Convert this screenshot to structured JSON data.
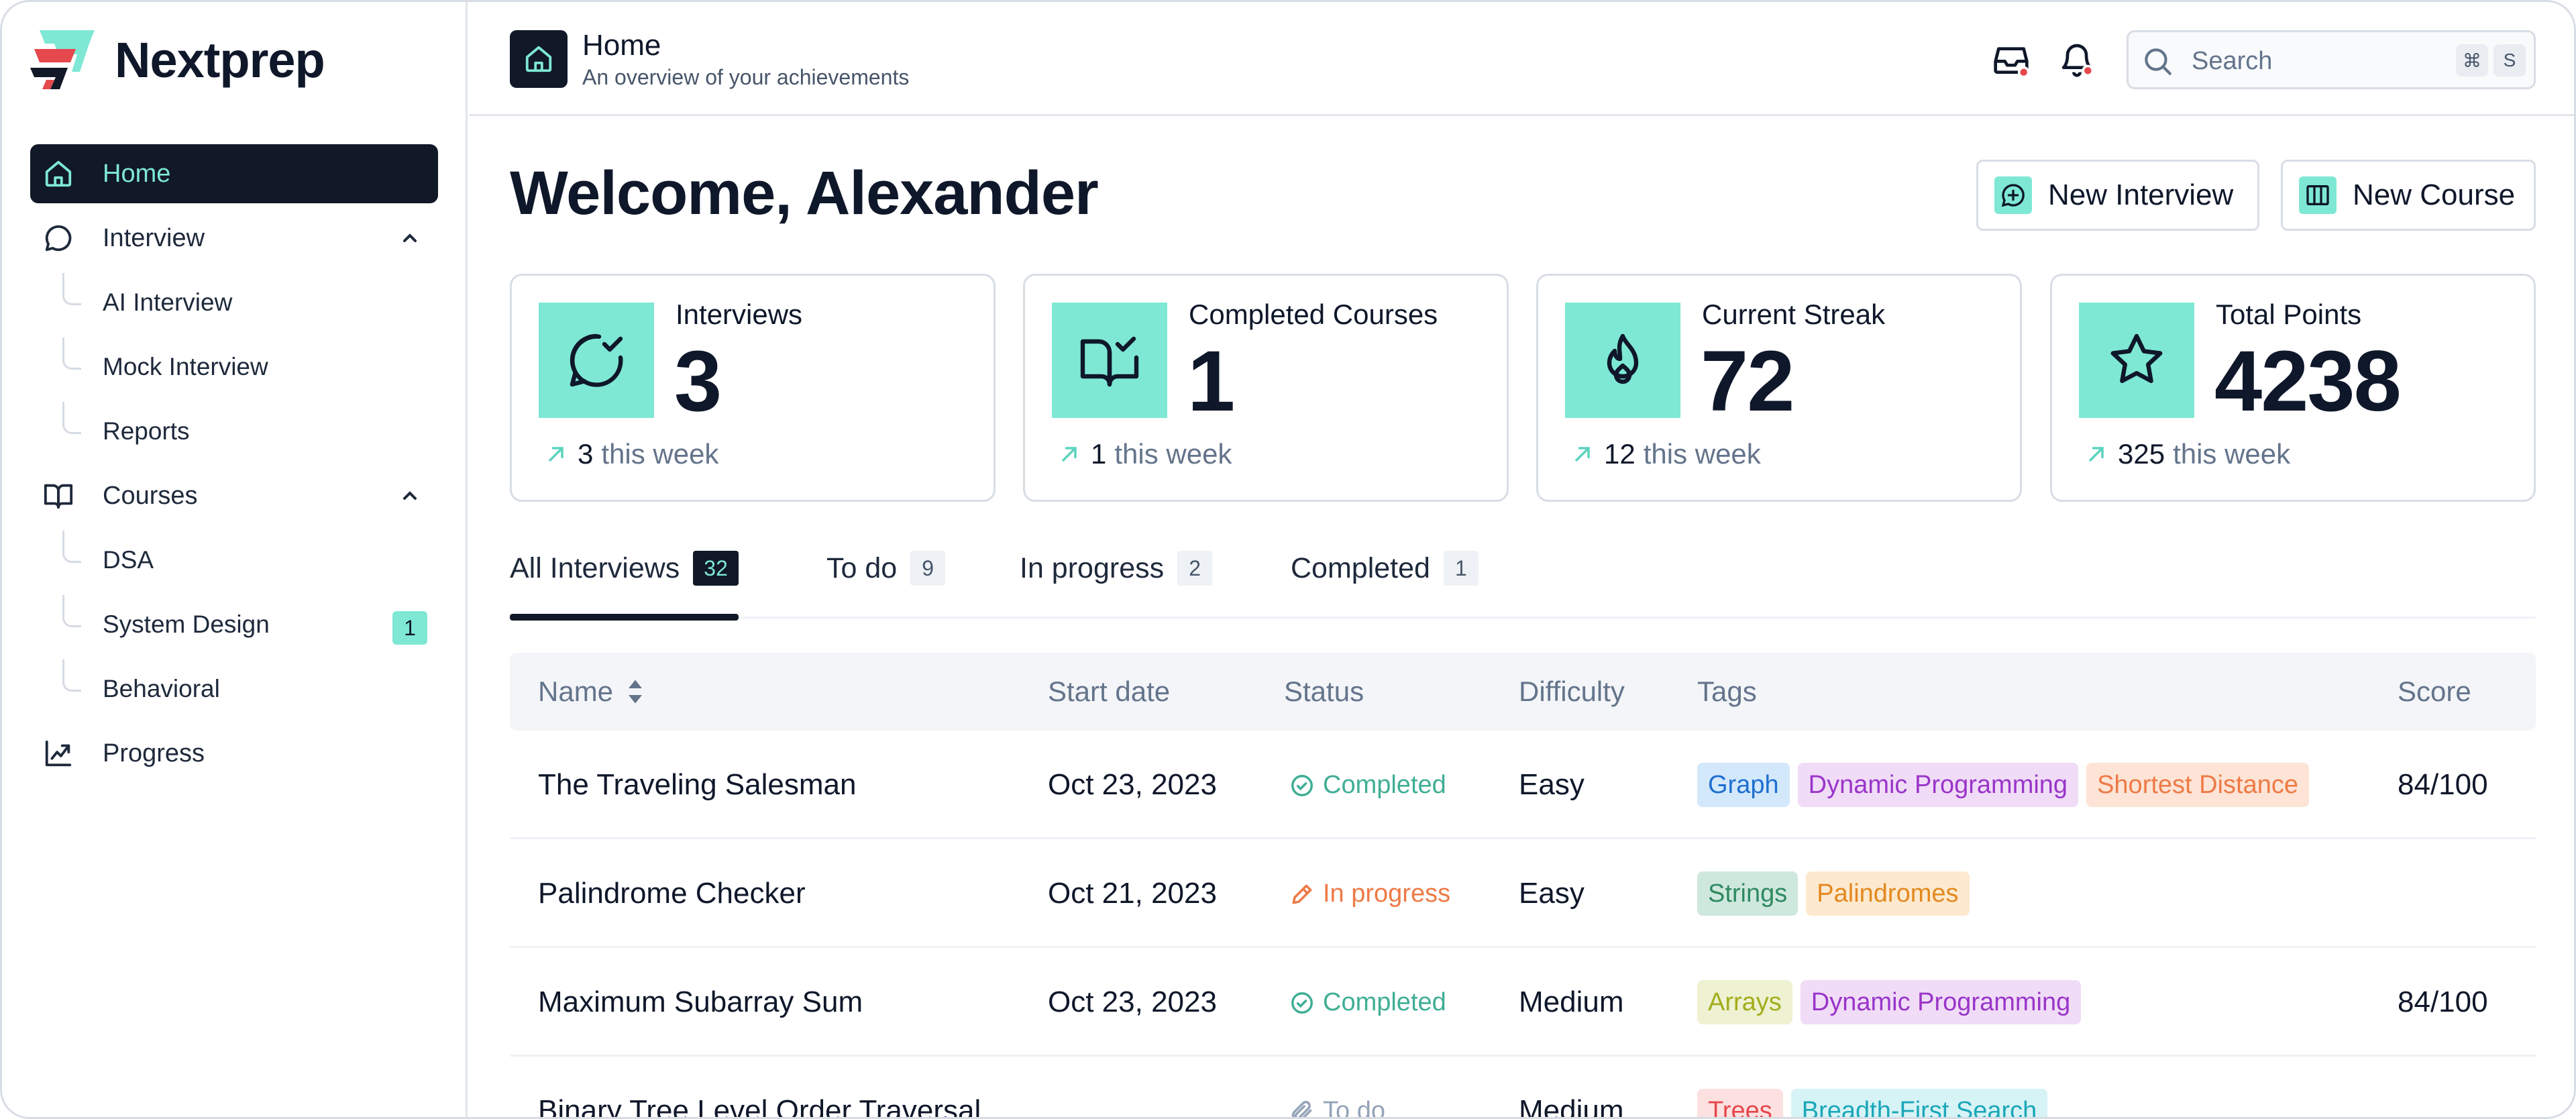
{
  "app": {
    "name": "Nextprep",
    "colors": {
      "accent": "#7ee8d4",
      "dark": "#111827"
    }
  },
  "sidebar": {
    "items": [
      {
        "label": "Home",
        "icon": "home-icon",
        "active": true
      },
      {
        "label": "Interview",
        "icon": "chat-bubble-icon",
        "expanded": true,
        "children": [
          {
            "label": "AI Interview"
          },
          {
            "label": "Mock Interview"
          },
          {
            "label": "Reports"
          }
        ]
      },
      {
        "label": "Courses",
        "icon": "book-open-icon",
        "expanded": true,
        "children": [
          {
            "label": "DSA"
          },
          {
            "label": "System Design",
            "badge": "1"
          },
          {
            "label": "Behavioral"
          }
        ]
      },
      {
        "label": "Progress",
        "icon": "chart-trend-icon"
      }
    ]
  },
  "header": {
    "title": "Home",
    "subtitle": "An overview of your achievements",
    "search_placeholder": "Search",
    "shortcut_keys": [
      "⌘",
      "S"
    ]
  },
  "main": {
    "welcome": "Welcome, Alexander",
    "buttons": {
      "new_interview": "New Interview",
      "new_course": "New Course"
    },
    "stats": [
      {
        "label": "Interviews",
        "value": "3",
        "week_value": "3",
        "week_label": "this week",
        "icon": "chat-check-icon"
      },
      {
        "label": "Completed Courses",
        "value": "1",
        "week_value": "1",
        "week_label": "this week",
        "icon": "book-check-icon"
      },
      {
        "label": "Current Streak",
        "value": "72",
        "week_value": "12",
        "week_label": "this week",
        "icon": "flame-icon"
      },
      {
        "label": "Total Points",
        "value": "4238",
        "week_value": "325",
        "week_label": "this week",
        "icon": "star-icon"
      }
    ],
    "tabs": [
      {
        "label": "All Interviews",
        "count": "32",
        "active": true
      },
      {
        "label": "To do",
        "count": "9"
      },
      {
        "label": "In progress",
        "count": "2"
      },
      {
        "label": "Completed",
        "count": "1"
      }
    ],
    "table": {
      "columns": {
        "name": "Name",
        "start_date": "Start date",
        "status": "Status",
        "difficulty": "Difficulty",
        "tags": "Tags",
        "score": "Score"
      },
      "rows": [
        {
          "name": "The Traveling Salesman",
          "start_date": "Oct 23, 2023",
          "status": "Completed",
          "difficulty": "Easy",
          "tags": [
            "Graph",
            "Dynamic Programming",
            "Shortest Distance"
          ],
          "score": "84/100"
        },
        {
          "name": "Palindrome Checker",
          "start_date": "Oct 21, 2023",
          "status": "In progress",
          "difficulty": "Easy",
          "tags": [
            "Strings",
            "Palindromes"
          ],
          "score": ""
        },
        {
          "name": "Maximum Subarray Sum",
          "start_date": "Oct 23, 2023",
          "status": "Completed",
          "difficulty": "Medium",
          "tags": [
            "Arrays",
            "Dynamic Programming"
          ],
          "score": "84/100"
        },
        {
          "name": "Binary Tree Level Order Traversal",
          "start_date": "",
          "status": "To do",
          "difficulty": "Medium",
          "tags": [
            "Trees",
            "Breadth-First Search"
          ],
          "score": ""
        }
      ]
    }
  }
}
